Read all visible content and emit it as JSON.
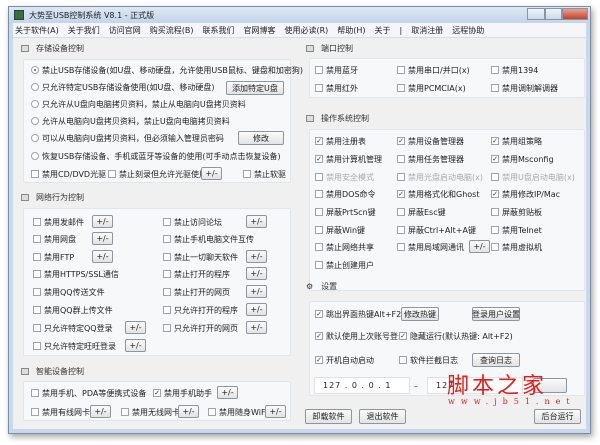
{
  "window": {
    "title": "大势至USB控制系统 V8.1 - 正式版"
  },
  "menu": [
    "关于软件(A)",
    "关于我们",
    "访问官网",
    "购买流程(B)",
    "联系我们",
    "官网博客",
    "使用必读(R)",
    "帮助(H)",
    "关于",
    "|",
    "取消注册",
    "远程协助"
  ],
  "storage": {
    "title": "存储设备控制",
    "radios": [
      {
        "label": "禁止USB存储设备(如U盘、移动硬盘，允许使用USB鼠标、键盘和加密狗)",
        "checked": true
      },
      {
        "label": "只允许特定USB存储设备使用(如U盘、移动硬盘)",
        "checked": false
      },
      {
        "label": "只允许从U盘向电脑拷贝资料，禁止从电脑向U盘拷贝资料",
        "checked": false
      },
      {
        "label": "允许从电脑向U盘拷贝资料，禁止U盘向电脑拷贝资料",
        "checked": false
      },
      {
        "label": "可以从电脑向U盘拷贝资料，但必须输入管理员密码",
        "checked": false
      },
      {
        "label": "恢复USB存储设备、手机或蓝牙等设备的使用(可手动点击恢复设备)",
        "checked": false
      }
    ],
    "add_button": "添加特定U盘",
    "modify_button": "修改",
    "cd": "禁用CD/DVD光驱",
    "burn": "禁止刻录但允许光驱使用",
    "floppy": "禁止软驱",
    "pm": "+/-"
  },
  "network": {
    "title": "网络行为控制",
    "left": [
      {
        "label": "禁用发邮件",
        "btn": "+/-"
      },
      {
        "label": "禁用网盘",
        "btn": "+/-"
      },
      {
        "label": "禁用FTP",
        "btn": "+/-"
      },
      {
        "label": "禁用HTTPS/SSL通信"
      },
      {
        "label": "禁用QQ传送文件"
      },
      {
        "label": "禁用QQ群上传文件"
      },
      {
        "label": "只允许特定QQ登录",
        "btn": "+/-"
      },
      {
        "label": "只允许特定旺旺登录",
        "btn": "+/-"
      }
    ],
    "right": [
      {
        "label": "禁止访问论坛",
        "btn": "+/-"
      },
      {
        "label": "禁止手机电脑文件互传"
      },
      {
        "label": "禁止一切聊天软件",
        "btn": "+/-"
      },
      {
        "label": "禁止打开的程序",
        "btn": "+/-"
      },
      {
        "label": "禁止打开的网页",
        "btn": "+/-"
      },
      {
        "label": "只允许打开的程序",
        "btn": "+/-"
      },
      {
        "label": "只允许打开的网页",
        "btn": "+/-"
      }
    ]
  },
  "smart": {
    "title": "智能设备控制",
    "items": [
      {
        "label": "禁用手机、PDA等便携式设备",
        "checked": false
      },
      {
        "label": "禁用手机助手",
        "checked": true
      },
      {
        "label": "禁用有线网卡",
        "checked": false
      },
      {
        "label": "禁用无线网卡",
        "checked": false
      },
      {
        "label": "禁用随身WiFi",
        "checked": false
      }
    ],
    "pm": "+/-"
  },
  "ports": {
    "title": "端口控制",
    "items": [
      "禁用蓝牙",
      "禁用串口/并口(x)",
      "禁用1394",
      "禁用红外",
      "禁用PCMCIA(x)",
      "禁用调制解调器"
    ]
  },
  "os": {
    "title": "操作系统控制",
    "items": [
      {
        "label": "禁用注册表",
        "checked": true
      },
      {
        "label": "禁用设备管理器",
        "checked": true
      },
      {
        "label": "禁用组策略",
        "checked": true
      },
      {
        "label": "禁用计算机管理",
        "checked": true
      },
      {
        "label": "禁用任务管理器",
        "checked": false
      },
      {
        "label": "禁用Msconfig",
        "checked": true
      },
      {
        "label": "禁用安全模式",
        "checked": false,
        "disabled": true
      },
      {
        "label": "禁用光盘启动电脑(x)",
        "checked": false,
        "disabled": true
      },
      {
        "label": "禁用U盘启动电脑(x)",
        "checked": false,
        "disabled": true
      },
      {
        "label": "禁用DOS命令",
        "checked": false
      },
      {
        "label": "禁用格式化和Ghost",
        "checked": true
      },
      {
        "label": "禁用修改IP/Mac",
        "checked": true
      },
      {
        "label": "屏蔽PrtScn键",
        "checked": false
      },
      {
        "label": "屏蔽Esc键",
        "checked": false
      },
      {
        "label": "屏蔽剪贴板",
        "checked": false
      },
      {
        "label": "屏蔽Win键",
        "checked": false
      },
      {
        "label": "屏蔽Ctrl+Alt+A键",
        "checked": false
      },
      {
        "label": "禁用Telnet",
        "checked": false
      },
      {
        "label": "禁止网络共享",
        "checked": false
      },
      {
        "label": "禁用局域网通讯",
        "checked": false
      },
      {
        "label": "禁用虚拟机",
        "checked": false
      },
      {
        "label": "禁止创建用户",
        "checked": false
      }
    ],
    "pm": "+/-"
  },
  "settings": {
    "title": "设置",
    "items": [
      {
        "label": "跳出界面热键Alt+F2",
        "checked": true
      },
      {
        "label": "默认使用上次账号登录",
        "checked": true
      },
      {
        "label": "隐藏运行(默认热键: Alt+F2)",
        "checked": true
      },
      {
        "label": "开机自动启动",
        "checked": true
      },
      {
        "label": "软件拦截日志",
        "checked": false
      }
    ],
    "hotkey_button": "修改热键",
    "login_button": "登录用户设置",
    "log_button": "查询日志",
    "ip_from": "127 . 0 . 0 . 1",
    "ip_sep": "–",
    "ip_to": "127"
  },
  "footer": {
    "uninstall": "卸载软件",
    "exit": "退出软件",
    "background": "后台运行"
  },
  "watermark": {
    "cn": "脚本之家",
    "url": "www.jb51.net"
  }
}
